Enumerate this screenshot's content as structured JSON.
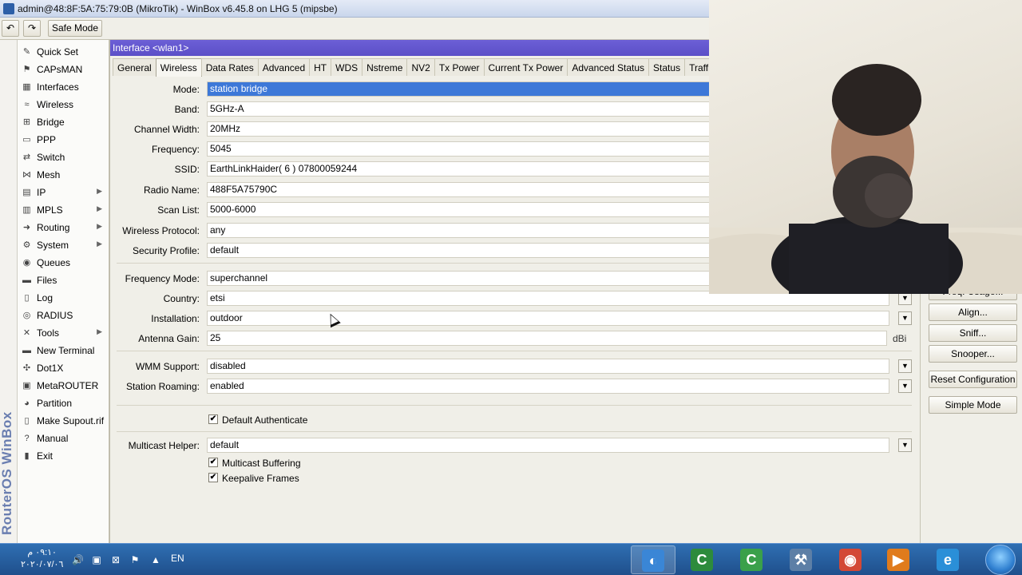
{
  "window": {
    "title": "admin@48:8F:5A:75:79:0B (MikroTik) - WinBox v6.45.8 on LHG 5 (mipsbe)"
  },
  "toolbar": {
    "undo_icon": "undo-icon",
    "redo_icon": "redo-icon",
    "safe_mode_label": "Safe Mode"
  },
  "brand": "RouterOS WinBox",
  "sidebar": {
    "items": [
      {
        "label": "Quick Set",
        "icon": "quick-set-icon",
        "glyph": "✎",
        "submenu": false
      },
      {
        "label": "CAPsMAN",
        "icon": "capsman-icon",
        "glyph": "⚑",
        "submenu": false
      },
      {
        "label": "Interfaces",
        "icon": "interfaces-icon",
        "glyph": "▦",
        "submenu": false
      },
      {
        "label": "Wireless",
        "icon": "wireless-icon",
        "glyph": "≈",
        "submenu": false
      },
      {
        "label": "Bridge",
        "icon": "bridge-icon",
        "glyph": "⊞",
        "submenu": false
      },
      {
        "label": "PPP",
        "icon": "ppp-icon",
        "glyph": "▭",
        "submenu": false
      },
      {
        "label": "Switch",
        "icon": "switch-icon",
        "glyph": "⇄",
        "submenu": false
      },
      {
        "label": "Mesh",
        "icon": "mesh-icon",
        "glyph": "⋈",
        "submenu": false
      },
      {
        "label": "IP",
        "icon": "ip-icon",
        "glyph": "▤",
        "submenu": true
      },
      {
        "label": "MPLS",
        "icon": "mpls-icon",
        "glyph": "▥",
        "submenu": true
      },
      {
        "label": "Routing",
        "icon": "routing-icon",
        "glyph": "➜",
        "submenu": true
      },
      {
        "label": "System",
        "icon": "system-icon",
        "glyph": "⚙",
        "submenu": true
      },
      {
        "label": "Queues",
        "icon": "queues-icon",
        "glyph": "◉",
        "submenu": false
      },
      {
        "label": "Files",
        "icon": "files-icon",
        "glyph": "▬",
        "submenu": false
      },
      {
        "label": "Log",
        "icon": "log-icon",
        "glyph": "▯",
        "submenu": false
      },
      {
        "label": "RADIUS",
        "icon": "radius-icon",
        "glyph": "◎",
        "submenu": false
      },
      {
        "label": "Tools",
        "icon": "tools-icon",
        "glyph": "✕",
        "submenu": true
      },
      {
        "label": "New Terminal",
        "icon": "terminal-icon",
        "glyph": "▬",
        "submenu": false
      },
      {
        "label": "Dot1X",
        "icon": "dot1x-icon",
        "glyph": "✣",
        "submenu": false
      },
      {
        "label": "MetaROUTER",
        "icon": "metarouter-icon",
        "glyph": "▣",
        "submenu": false
      },
      {
        "label": "Partition",
        "icon": "partition-icon",
        "glyph": "◕",
        "submenu": false
      },
      {
        "label": "Make Supout.rif",
        "icon": "supout-icon",
        "glyph": "▯",
        "submenu": false
      },
      {
        "label": "Manual",
        "icon": "manual-icon",
        "glyph": "?",
        "submenu": false
      },
      {
        "label": "Exit",
        "icon": "exit-icon",
        "glyph": "▮",
        "submenu": false
      }
    ]
  },
  "interface_window": {
    "title": "Interface <wlan1>",
    "tabs": [
      "General",
      "Wireless",
      "Data Rates",
      "Advanced",
      "HT",
      "WDS",
      "Nstreme",
      "NV2",
      "Tx Power",
      "Current Tx Power",
      "Advanced Status",
      "Status",
      "Traffic"
    ],
    "active_tab": "Wireless",
    "fields": {
      "mode": {
        "label": "Mode:",
        "value": "station bridge"
      },
      "band": {
        "label": "Band:",
        "value": "5GHz-A"
      },
      "channel_width": {
        "label": "Channel Width:",
        "value": "20MHz"
      },
      "frequency": {
        "label": "Frequency:",
        "value": "5045"
      },
      "ssid": {
        "label": "SSID:",
        "value": "EarthLinkHaider( 6 ) 07800059244"
      },
      "radio_name": {
        "label": "Radio Name:",
        "value": "488F5A75790C"
      },
      "scan_list": {
        "label": "Scan List:",
        "value": "5000-6000"
      },
      "wireless_protocol": {
        "label": "Wireless Protocol:",
        "value": "any"
      },
      "security_profile": {
        "label": "Security Profile:",
        "value": "default"
      },
      "frequency_mode": {
        "label": "Frequency Mode:",
        "value": "superchannel"
      },
      "country": {
        "label": "Country:",
        "value": "etsi"
      },
      "installation": {
        "label": "Installation:",
        "value": "outdoor"
      },
      "antenna_gain": {
        "label": "Antenna Gain:",
        "value": "25",
        "unit": "dBi"
      },
      "wmm_support": {
        "label": "WMM Support:",
        "value": "disabled"
      },
      "station_roaming": {
        "label": "Station Roaming:",
        "value": "enabled"
      },
      "multicast_helper": {
        "label": "Multicast Helper:",
        "value": "default"
      }
    },
    "checkboxes": {
      "default_authenticate": {
        "label": "Default Authenticate",
        "checked": true
      },
      "multicast_buffering": {
        "label": "Multicast Buffering",
        "checked": true
      },
      "keepalive_frames": {
        "label": "Keepalive Frames",
        "checked": true
      }
    }
  },
  "right_panel": {
    "freq_usage_label": "Freq. Usage...",
    "align_label": "Align...",
    "sniff_label": "Sniff...",
    "snooper_label": "Snooper...",
    "reset_label": "Reset Configuration",
    "simple_mode_label": "Simple Mode"
  },
  "taskbar": {
    "clock_time": "٠٩:١٠ م",
    "clock_date": "٢٠٢٠/٠٧/٠٦",
    "language": "EN",
    "apps": [
      {
        "name": "winbox-app",
        "icon": "winbox-icon",
        "color": "#3a86d6",
        "glyph": "◐"
      },
      {
        "name": "camtasia-app",
        "icon": "camtasia-icon",
        "color": "#2d8b3c",
        "glyph": "C"
      },
      {
        "name": "camtasia-recorder-app",
        "icon": "camtasia-recorder-icon",
        "color": "#3aa04a",
        "glyph": "C"
      },
      {
        "name": "network-app",
        "icon": "network-icon",
        "color": "#5d7fa6",
        "glyph": "⚒"
      },
      {
        "name": "chrome-app",
        "icon": "chrome-icon",
        "color": "#d34836",
        "glyph": "◉"
      },
      {
        "name": "media-player-app",
        "icon": "media-player-icon",
        "color": "#e07b1c",
        "glyph": "▶"
      },
      {
        "name": "ie-app",
        "icon": "internet-explorer-icon",
        "color": "#2a8fd8",
        "glyph": "e"
      }
    ]
  }
}
